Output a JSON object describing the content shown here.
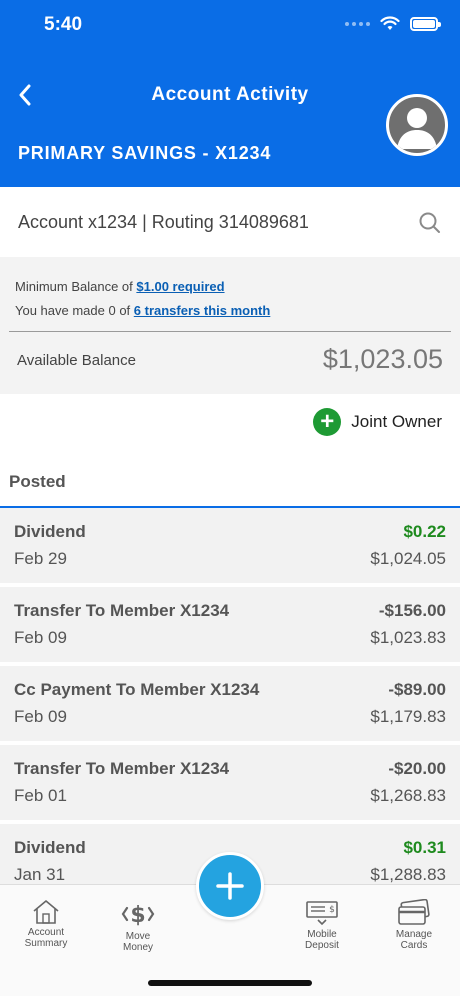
{
  "status": {
    "time": "5:40"
  },
  "header": {
    "title": "Account Activity",
    "account_name": "PRIMARY SAVINGS - X1234"
  },
  "account_bar": {
    "info": "Account x1234 | Routing 314089681"
  },
  "info": {
    "min_balance_prefix": "Minimum Balance of ",
    "min_balance_link": "$1.00 required",
    "transfers_prefix": "You have made 0 of ",
    "transfers_link": "6 transfers this month",
    "available_label": "Available Balance",
    "available_value": "$1,023.05"
  },
  "joint_owner": {
    "label": "Joint Owner"
  },
  "posted": {
    "label": "Posted"
  },
  "transactions": [
    {
      "description": "Dividend",
      "date": "Feb 29",
      "amount": "$0.22",
      "balance": "$1,024.05"
    },
    {
      "description": "Transfer To Member X1234",
      "date": "Feb 09",
      "amount": "-$156.00",
      "balance": "$1,023.83"
    },
    {
      "description": "Cc Payment To Member X1234",
      "date": "Feb 09",
      "amount": "-$89.00",
      "balance": "$1,179.83"
    },
    {
      "description": "Transfer To Member X1234",
      "date": "Feb 01",
      "amount": "-$20.00",
      "balance": "$1,268.83"
    },
    {
      "description": "Dividend",
      "date": "Jan 31",
      "amount": "$0.31",
      "balance": "$1,288.83"
    }
  ],
  "tabs": [
    {
      "label": "Account Summary",
      "icon": "house-icon"
    },
    {
      "label": "Move Money",
      "icon": "dollar-arrows-icon"
    },
    {
      "label": "Mobile Deposit",
      "icon": "check-deposit-icon"
    },
    {
      "label": "Manage Cards",
      "icon": "card-icon"
    }
  ],
  "colors": {
    "primary": "#0a6de6",
    "positive": "#1e8a1e",
    "fab": "#24a3e0",
    "joint": "#1e9a34"
  }
}
